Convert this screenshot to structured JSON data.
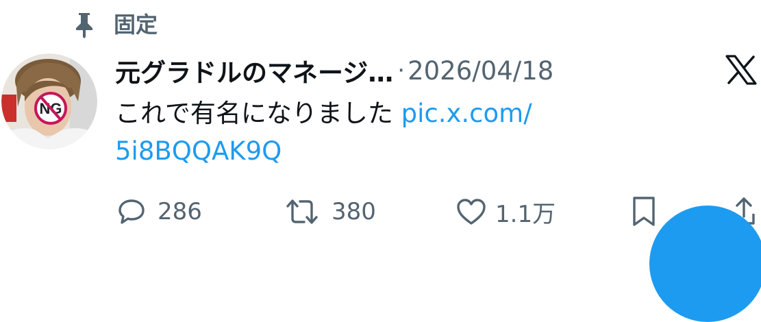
{
  "pinned": {
    "label": "固定",
    "icon": "pin-icon"
  },
  "tweet": {
    "avatar": {
      "badge_text": "NG",
      "icon": "avatar"
    },
    "display_name": "元グラドルのマネージ…",
    "separator": "·",
    "timestamp": "2026/04/18",
    "text": "これで有名になりました",
    "link_line1": "pic.x.com/",
    "link_line2": "5i8BQQAK9Q"
  },
  "actions": {
    "reply": {
      "count": "286",
      "icon": "reply-icon"
    },
    "retweet": {
      "count": "380",
      "icon": "retweet-icon"
    },
    "like": {
      "count": "1.1万",
      "icon": "heart-icon"
    },
    "bookmark": {
      "icon": "bookmark-icon"
    },
    "share": {
      "icon": "share-icon"
    }
  },
  "colors": {
    "link": "#1d9bf0",
    "muted": "#536471",
    "text": "#0f1419",
    "accent": "#1d9bf0"
  }
}
